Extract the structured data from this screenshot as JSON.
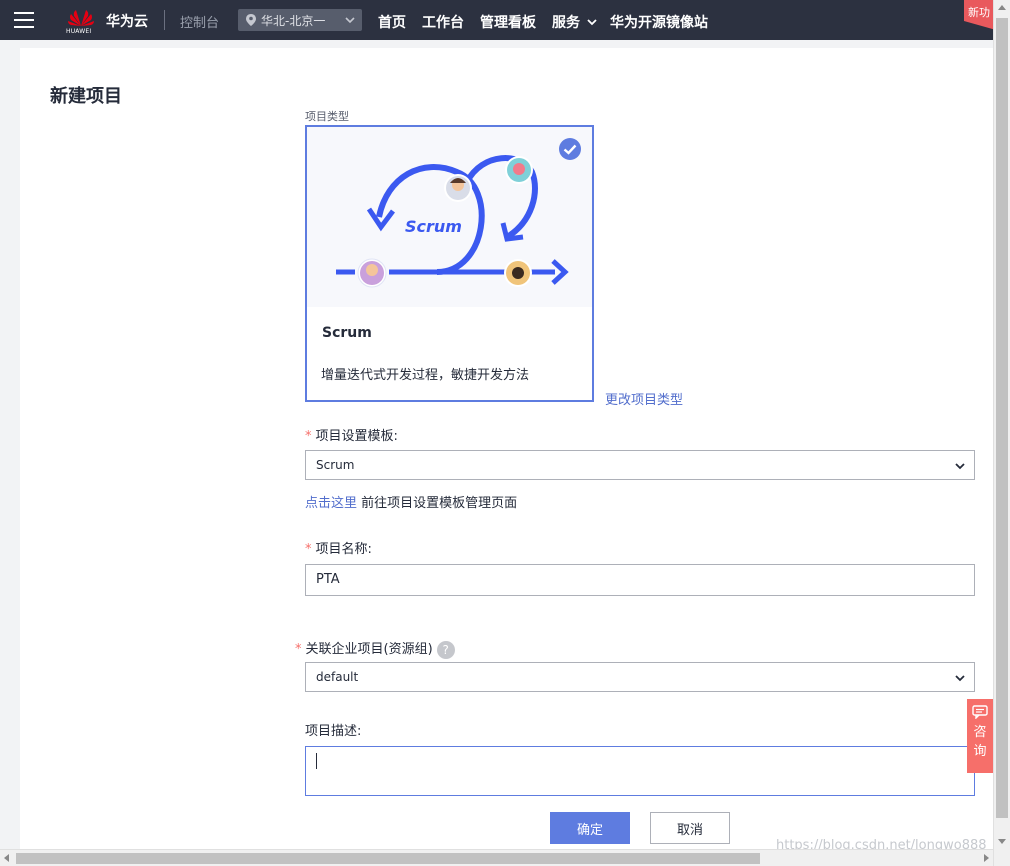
{
  "topbar": {
    "brand": "华为云",
    "logo_text": "HUAWEI",
    "console": "控制台",
    "region": "华北-北京一",
    "nav": [
      {
        "label": "首页"
      },
      {
        "label": "工作台"
      },
      {
        "label": "管理看板"
      },
      {
        "label": "服务"
      },
      {
        "label": "华为开源镜像站"
      }
    ],
    "ribbon": "新功"
  },
  "page": {
    "title": "新建项目"
  },
  "project_type": {
    "label": "项目类型",
    "illustration_text": "Scrum",
    "name": "Scrum",
    "description": "增量迭代式开发过程，敏捷开发方法",
    "change_link": "更改项目类型"
  },
  "template": {
    "label": "项目设置模板:",
    "value": "Scrum",
    "hint_link": "点击这里",
    "hint_text": " 前往项目设置模板管理页面"
  },
  "project_name": {
    "label": "项目名称:",
    "value": "PTA"
  },
  "enterprise_project": {
    "label": "关联企业项目(资源组)",
    "help": "?",
    "value": "default"
  },
  "description": {
    "label": "项目描述:"
  },
  "buttons": {
    "confirm": "确定",
    "cancel": "取消"
  },
  "consult": {
    "line1": "咨",
    "line2": "询"
  },
  "watermark": "https://blog.csdn.net/longwo888",
  "colors": {
    "topbar": "#2c3140",
    "primary": "#5e7ce0",
    "link": "#526ecc",
    "required": "#f66f6a",
    "scrum_arrow": "#3b59f0"
  }
}
